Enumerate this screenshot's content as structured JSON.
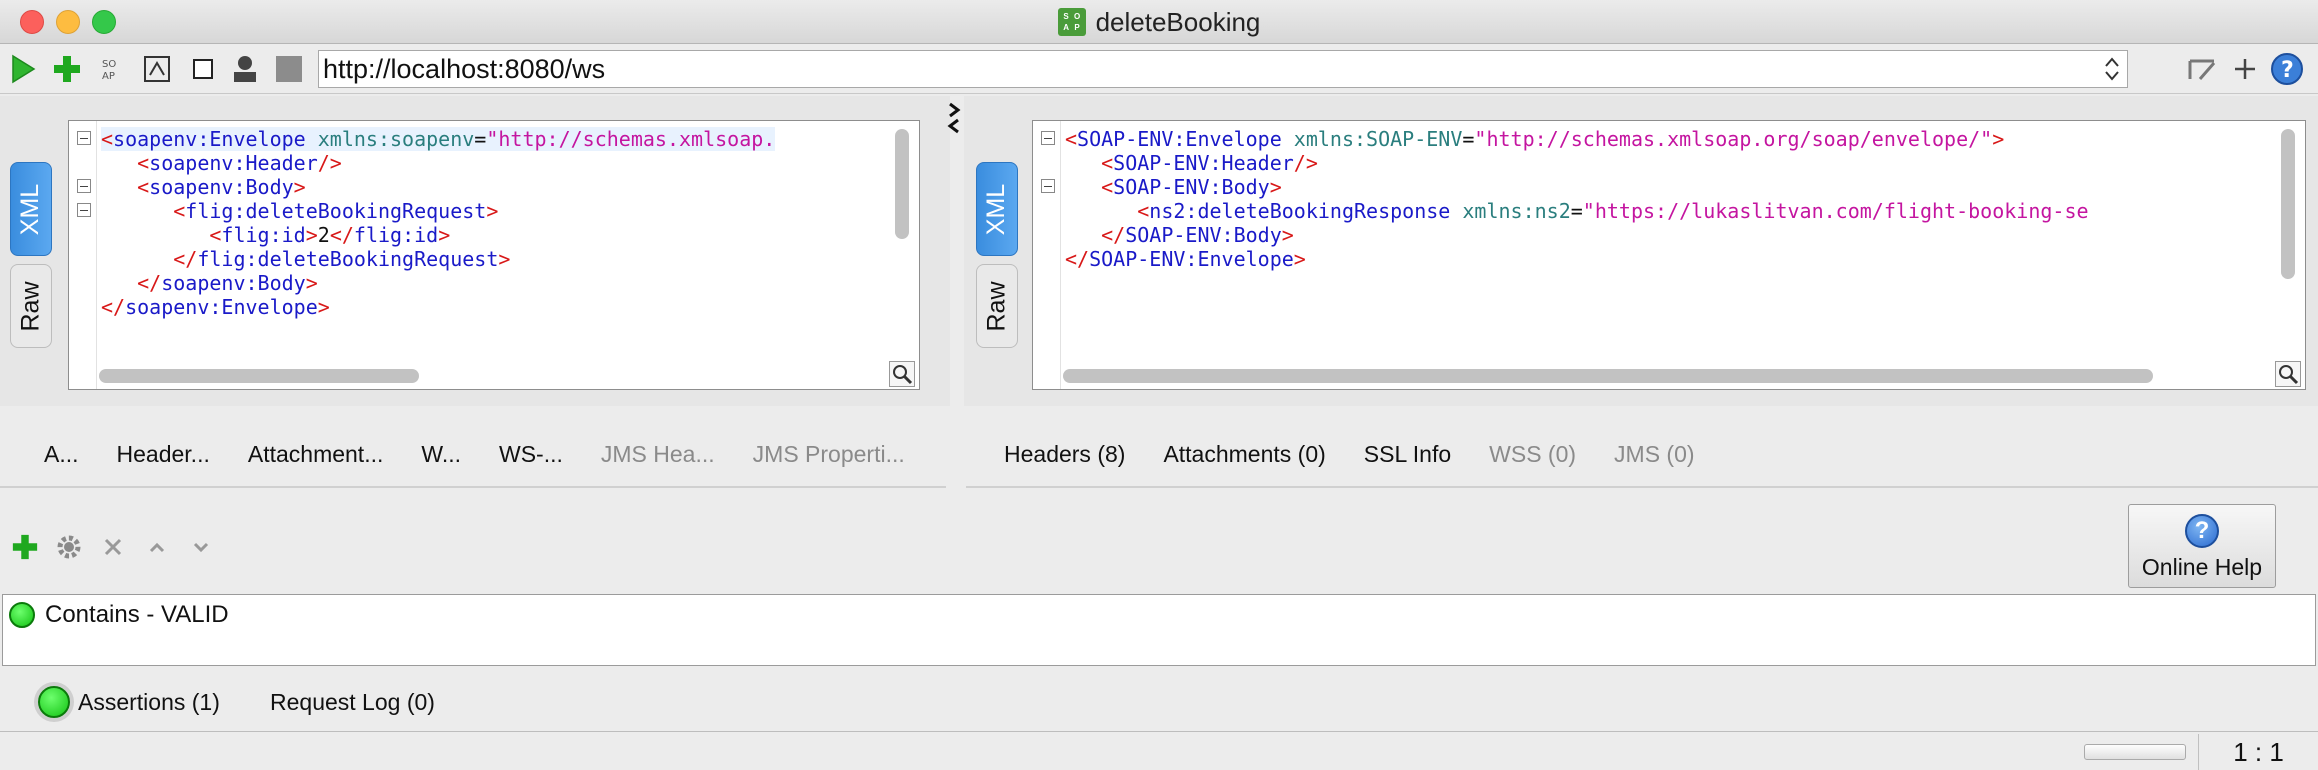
{
  "window": {
    "title": "deleteBooking",
    "badge": [
      "S",
      "O",
      "A",
      "P"
    ]
  },
  "toolbar": {
    "url": "http://localhost:8080/ws",
    "icons": [
      "run-icon",
      "add-icon",
      "soap-ws-icon",
      "format-icon",
      "stop-square-icon",
      "user-icon",
      "cancel-icon"
    ],
    "right_icons": [
      "edit-icon",
      "plus-icon",
      "help-icon"
    ]
  },
  "request_editor": {
    "tabs": {
      "xml": "XML",
      "raw": "Raw"
    },
    "lines": [
      [
        [
          "bk",
          "<"
        ],
        [
          "tg",
          "soapenv:Envelope "
        ],
        [
          "at",
          "xmlns:soapenv"
        ],
        [
          "tx",
          "="
        ],
        [
          "st",
          "\"http://schemas.xmlsoap."
        ]
      ],
      [
        [
          "tx",
          "   "
        ],
        [
          "bk",
          "<"
        ],
        [
          "tg",
          "soapenv:Header"
        ],
        [
          "bk",
          "/>"
        ]
      ],
      [
        [
          "tx",
          "   "
        ],
        [
          "bk",
          "<"
        ],
        [
          "tg",
          "soapenv:Body"
        ],
        [
          "bk",
          ">"
        ]
      ],
      [
        [
          "tx",
          "      "
        ],
        [
          "bk",
          "<"
        ],
        [
          "tg",
          "flig:deleteBookingRequest"
        ],
        [
          "bk",
          ">"
        ]
      ],
      [
        [
          "tx",
          "         "
        ],
        [
          "bk",
          "<"
        ],
        [
          "tg",
          "flig:id"
        ],
        [
          "bk",
          ">"
        ],
        [
          "tx",
          "2"
        ],
        [
          "bk",
          "</"
        ],
        [
          "tg",
          "flig:id"
        ],
        [
          "bk",
          ">"
        ]
      ],
      [
        [
          "tx",
          "      "
        ],
        [
          "bk",
          "</"
        ],
        [
          "tg",
          "flig:deleteBookingRequest"
        ],
        [
          "bk",
          ">"
        ]
      ],
      [
        [
          "tx",
          "   "
        ],
        [
          "bk",
          "</"
        ],
        [
          "tg",
          "soapenv:Body"
        ],
        [
          "bk",
          ">"
        ]
      ],
      [
        [
          "bk",
          "</"
        ],
        [
          "tg",
          "soapenv:Envelope"
        ],
        [
          "bk",
          ">"
        ]
      ]
    ]
  },
  "response_editor": {
    "tabs": {
      "xml": "XML",
      "raw": "Raw"
    },
    "lines": [
      [
        [
          "bk",
          "<"
        ],
        [
          "tg",
          "SOAP-ENV:Envelope "
        ],
        [
          "at",
          "xmlns:SOAP-ENV"
        ],
        [
          "tx",
          "="
        ],
        [
          "st",
          "\"http://schemas.xmlsoap.org/soap/envelope/\""
        ],
        [
          "bk",
          ">"
        ]
      ],
      [
        [
          "tx",
          "   "
        ],
        [
          "bk",
          "<"
        ],
        [
          "tg",
          "SOAP-ENV:Header"
        ],
        [
          "bk",
          "/>"
        ]
      ],
      [
        [
          "tx",
          "   "
        ],
        [
          "bk",
          "<"
        ],
        [
          "tg",
          "SOAP-ENV:Body"
        ],
        [
          "bk",
          ">"
        ]
      ],
      [
        [
          "tx",
          "      "
        ],
        [
          "bk",
          "<"
        ],
        [
          "tg",
          "ns2:deleteBookingResponse "
        ],
        [
          "at",
          "xmlns:ns2"
        ],
        [
          "tx",
          "="
        ],
        [
          "st",
          "\"https://lukaslitvan.com/flight-booking-se"
        ]
      ],
      [
        [
          "tx",
          "   "
        ],
        [
          "bk",
          "</"
        ],
        [
          "tg",
          "SOAP-ENV:Body"
        ],
        [
          "bk",
          ">"
        ]
      ],
      [
        [
          "bk",
          "</"
        ],
        [
          "tg",
          "SOAP-ENV:Envelope"
        ],
        [
          "bk",
          ">"
        ]
      ]
    ]
  },
  "request_tabs": [
    "A...",
    "Header...",
    "Attachment...",
    "W...",
    "WS-...",
    "JMS Hea...",
    "JMS Properti..."
  ],
  "response_tabs": [
    "Headers (8)",
    "Attachments (0)",
    "SSL Info",
    "WSS (0)",
    "JMS (0)"
  ],
  "assertions_toolbar": {
    "icons": [
      "add-assertion-icon",
      "configure-icon",
      "remove-icon",
      "move-up-icon",
      "move-down-icon"
    ],
    "help_label": "Online Help"
  },
  "assertions": [
    {
      "label": "Contains - VALID",
      "status": "valid",
      "color": "#13c213"
    }
  ],
  "bottom_tabs": {
    "assertions": "Assertions (1)",
    "request_log": "Request Log (0)"
  },
  "status": {
    "ratio": "1 : 1"
  }
}
